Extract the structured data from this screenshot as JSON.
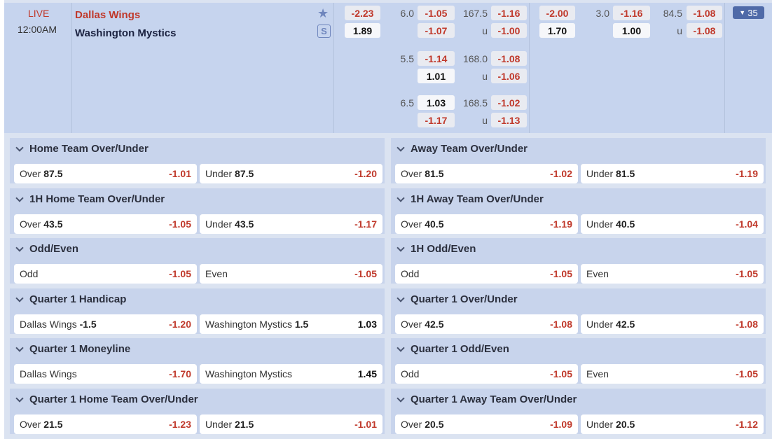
{
  "match": {
    "status": "LIVE",
    "time": "12:00AM",
    "home_team": "Dallas Wings",
    "away_team": "Washington Mystics",
    "more_count": "35",
    "more_icon": "triangle-down-icon"
  },
  "odds": {
    "ft_handicap": {
      "home": "-2.23",
      "away": "1.89"
    },
    "ft_hdp_rows": [
      {
        "line": "6.0",
        "home": "-1.05",
        "away": "-1.07"
      },
      {
        "line": "5.5",
        "home": "-1.14",
        "away": "1.01"
      },
      {
        "line": "6.5",
        "home": "1.03",
        "away": "-1.17"
      }
    ],
    "ft_ou_rows": [
      {
        "line": "167.5",
        "under_label": "u",
        "over": "-1.16",
        "under": "-1.00"
      },
      {
        "line": "168.0",
        "under_label": "u",
        "over": "-1.08",
        "under": "-1.06"
      },
      {
        "line": "168.5",
        "under_label": "u",
        "over": "-1.02",
        "under": "-1.13"
      }
    ],
    "h1_handicap": {
      "home": "-2.00",
      "away": "1.70"
    },
    "h1_hdp": {
      "line": "3.0",
      "home": "-1.16",
      "away": "1.00"
    },
    "h1_ou": {
      "line": "84.5",
      "under_label": "u",
      "over": "-1.08",
      "under": "-1.08"
    }
  },
  "markets": [
    {
      "title": "Home Team Over/Under",
      "sel": [
        {
          "label": "Over",
          "line": "87.5",
          "price": "-1.01"
        },
        {
          "label": "Under",
          "line": "87.5",
          "price": "-1.20"
        }
      ]
    },
    {
      "title": "Away Team Over/Under",
      "sel": [
        {
          "label": "Over",
          "line": "81.5",
          "price": "-1.02"
        },
        {
          "label": "Under",
          "line": "81.5",
          "price": "-1.19"
        }
      ]
    },
    {
      "title": "1H Home Team Over/Under",
      "sel": [
        {
          "label": "Over",
          "line": "43.5",
          "price": "-1.05"
        },
        {
          "label": "Under",
          "line": "43.5",
          "price": "-1.17"
        }
      ]
    },
    {
      "title": "1H Away Team Over/Under",
      "sel": [
        {
          "label": "Over",
          "line": "40.5",
          "price": "-1.19"
        },
        {
          "label": "Under",
          "line": "40.5",
          "price": "-1.04"
        }
      ]
    },
    {
      "title": "Odd/Even",
      "sel": [
        {
          "label": "Odd",
          "line": "",
          "price": "-1.05"
        },
        {
          "label": "Even",
          "line": "",
          "price": "-1.05"
        }
      ]
    },
    {
      "title": "1H Odd/Even",
      "sel": [
        {
          "label": "Odd",
          "line": "",
          "price": "-1.05"
        },
        {
          "label": "Even",
          "line": "",
          "price": "-1.05"
        }
      ]
    },
    {
      "title": "Quarter 1 Handicap",
      "sel": [
        {
          "label": "Dallas Wings",
          "line": "-1.5",
          "price": "-1.20"
        },
        {
          "label": "Washington Mystics",
          "line": "1.5",
          "price": "1.03"
        }
      ]
    },
    {
      "title": "Quarter 1 Over/Under",
      "sel": [
        {
          "label": "Over",
          "line": "42.5",
          "price": "-1.08"
        },
        {
          "label": "Under",
          "line": "42.5",
          "price": "-1.08"
        }
      ]
    },
    {
      "title": "Quarter 1 Moneyline",
      "sel": [
        {
          "label": "Dallas Wings",
          "line": "",
          "price": "-1.70"
        },
        {
          "label": "Washington Mystics",
          "line": "",
          "price": "1.45"
        }
      ]
    },
    {
      "title": "Quarter 1 Odd/Even",
      "sel": [
        {
          "label": "Odd",
          "line": "",
          "price": "-1.05"
        },
        {
          "label": "Even",
          "line": "",
          "price": "-1.05"
        }
      ]
    },
    {
      "title": "Quarter 1 Home Team Over/Under",
      "sel": [
        {
          "label": "Over",
          "line": "21.5",
          "price": "-1.23"
        },
        {
          "label": "Under",
          "line": "21.5",
          "price": "-1.01"
        }
      ]
    },
    {
      "title": "Quarter 1 Away Team Over/Under",
      "sel": [
        {
          "label": "Over",
          "line": "20.5",
          "price": "-1.09"
        },
        {
          "label": "Under",
          "line": "20.5",
          "price": "-1.12"
        }
      ]
    }
  ],
  "colors": {
    "negative": "#c0392b",
    "header_bg": "#c6d4ee",
    "accent": "#4f6aa8"
  }
}
